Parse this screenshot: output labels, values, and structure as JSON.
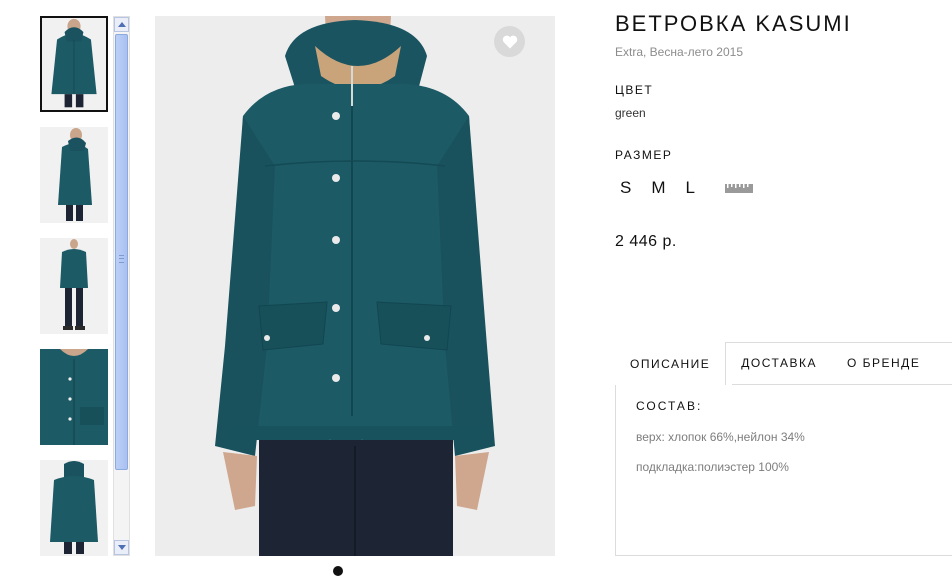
{
  "product": {
    "title": "ВЕТРОВКА KASUMI",
    "subtitle": "Extra, Весна-лето 2015",
    "price": "2 446 р."
  },
  "color": {
    "label": "ЦВЕТ",
    "value": "green",
    "swatch": "#1c5a66"
  },
  "size": {
    "label": "РАЗМЕР",
    "options": [
      "S",
      "M",
      "L"
    ],
    "size_chart_icon": "ruler-icon"
  },
  "gallery": {
    "thumbnail_count": 5,
    "selected_index": 0,
    "favorite_icon": "heart-icon"
  },
  "tabs": [
    {
      "label": "ОПИСАНИЕ",
      "active": true
    },
    {
      "label": "ДОСТАВКА",
      "active": false
    },
    {
      "label": "О БРЕНДЕ",
      "active": false
    }
  ],
  "description": {
    "heading": "СОСТАВ:",
    "lines": [
      "верх: хлопок 66%,нейлон 34%",
      "подкладка:полиэстер 100%"
    ]
  },
  "colors": {
    "jacket": "#1c5a66",
    "text": "#111111",
    "muted": "#8c8c8c",
    "border": "#dcdcdc"
  }
}
